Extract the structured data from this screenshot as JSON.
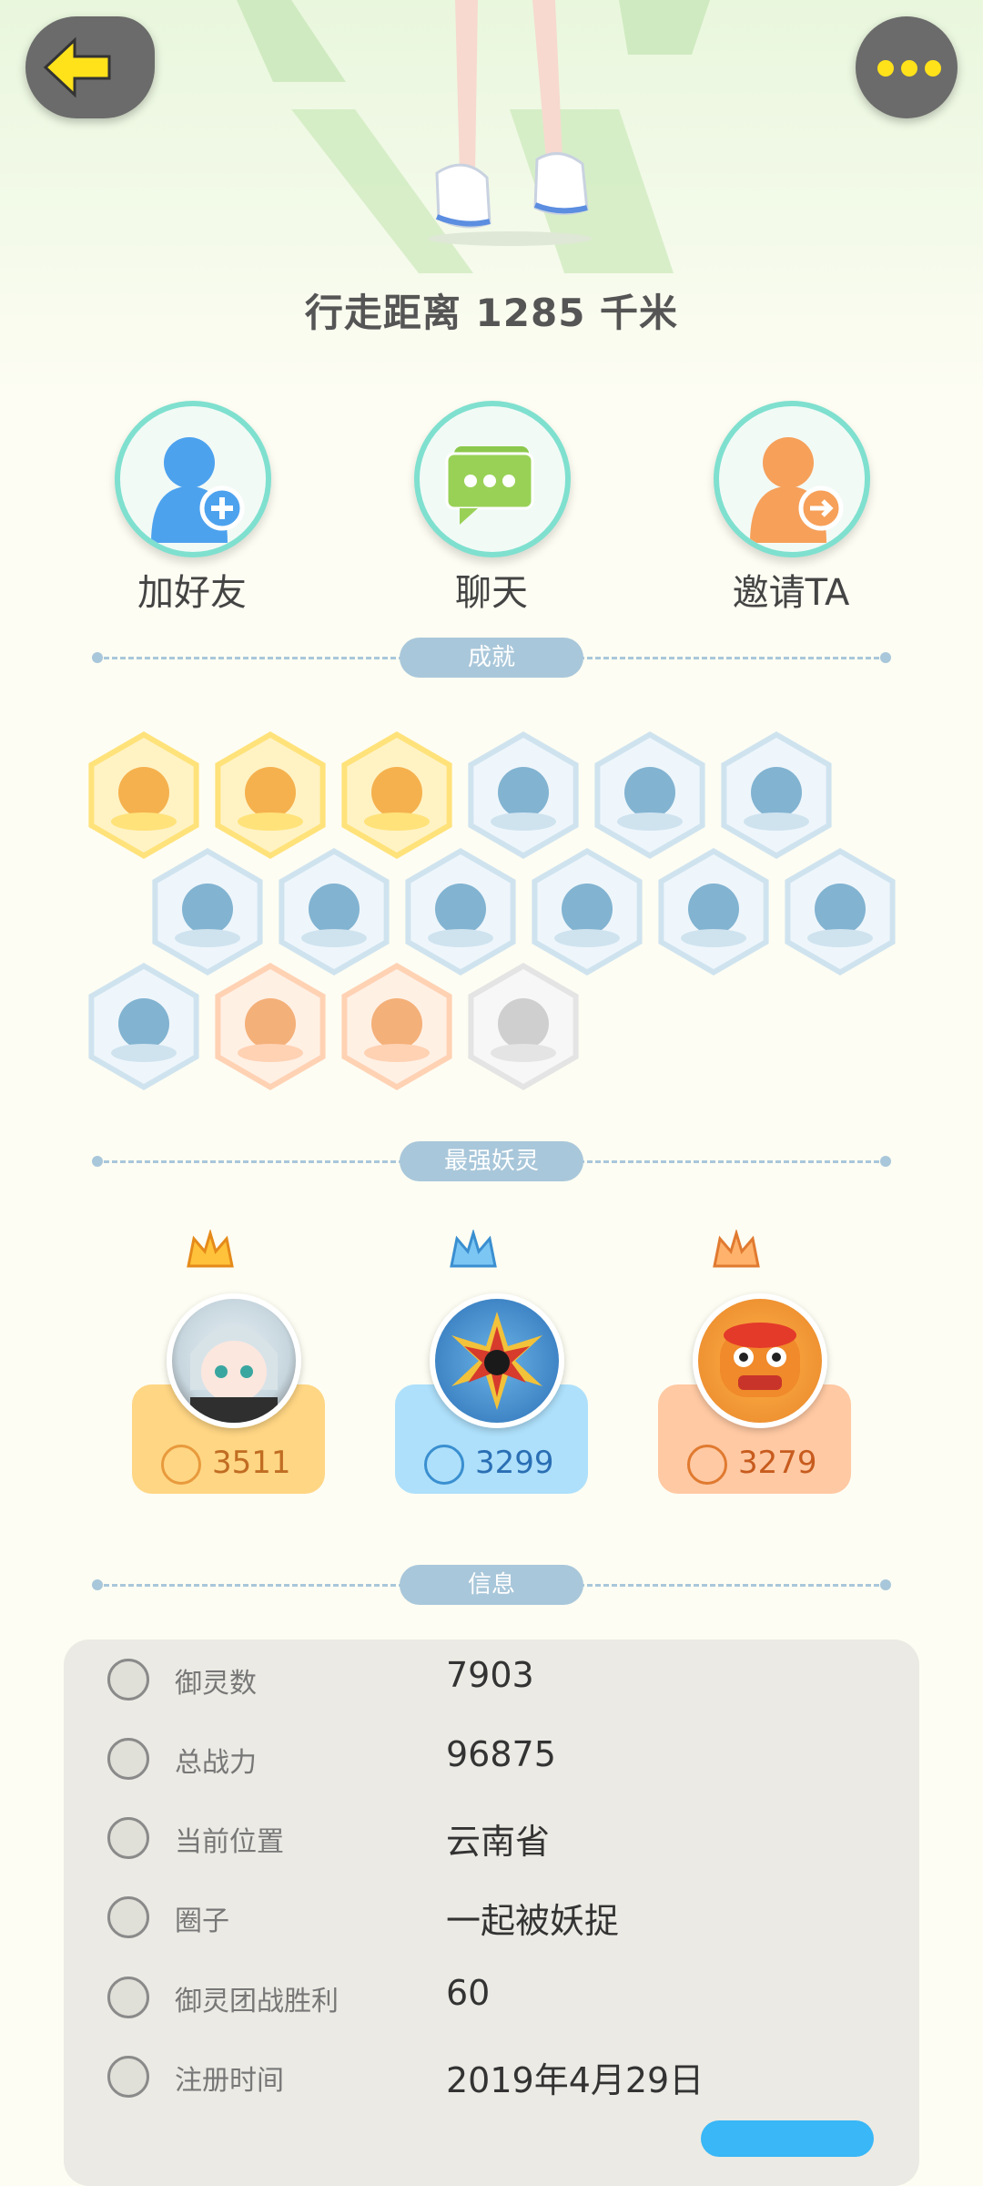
{
  "header": {
    "walk_text": "行走距离 1285 千米"
  },
  "actions": [
    {
      "label": "加好友",
      "icon": "add-friend-icon"
    },
    {
      "label": "聊天",
      "icon": "chat-icon"
    },
    {
      "label": "邀请TA",
      "icon": "invite-icon"
    }
  ],
  "sections": {
    "achievements": "成就",
    "strongest": "最强妖灵",
    "info": "信息"
  },
  "achievements": {
    "row1": [
      "gold",
      "gold",
      "gold",
      "blue",
      "blue",
      "blue"
    ],
    "row2": [
      "blue",
      "blue",
      "blue",
      "blue",
      "blue",
      "blue"
    ],
    "row3": [
      "blue",
      "orange",
      "orange",
      "gray"
    ]
  },
  "spirits": [
    {
      "power": "3511",
      "rank": "gold",
      "color": "#ffd684"
    },
    {
      "power": "3299",
      "rank": "blue",
      "color": "#aee0fb"
    },
    {
      "power": "3279",
      "rank": "orange",
      "color": "#ffc9a3"
    }
  ],
  "info": {
    "rows": [
      {
        "key": "御灵数",
        "value": "7903",
        "icon": "spirit-count-icon"
      },
      {
        "key": "总战力",
        "value": "96875",
        "icon": "sword-icon"
      },
      {
        "key": "当前位置",
        "value": "云南省",
        "icon": "location-pin-icon"
      },
      {
        "key": "圈子",
        "value": "一起被妖捉",
        "icon": "circle-group-icon"
      },
      {
        "key": "御灵团战胜利",
        "value": "60",
        "icon": "anchor-icon"
      },
      {
        "key": "注册时间",
        "value": "2019年4月29日",
        "icon": "clock-icon"
      }
    ]
  },
  "colors": {
    "accent_teal": "#7fe0cf",
    "divider": "#a9c7da",
    "back_arrow": "#ffe21a"
  }
}
